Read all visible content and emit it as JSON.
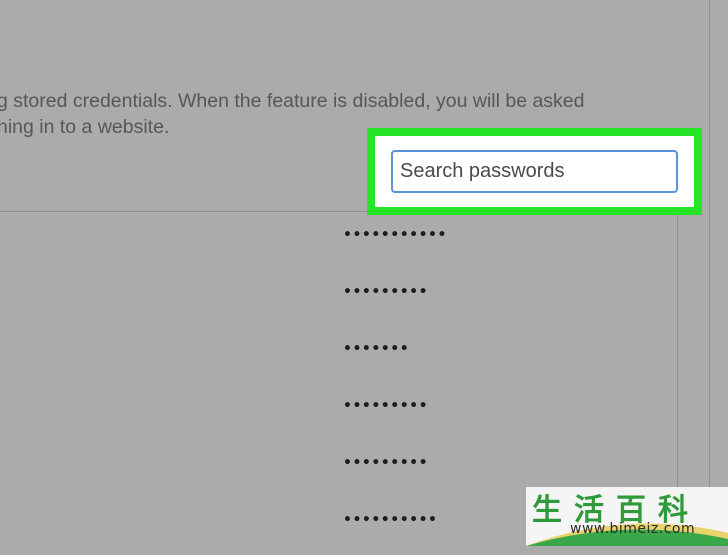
{
  "settings": {
    "description_line1": "g stored credentials. When the feature is disabled, you will be asked",
    "description_line2": "ning in to a website."
  },
  "search": {
    "placeholder": "Search passwords",
    "value": ""
  },
  "passwords": [
    {
      "masked": "•••••••••••"
    },
    {
      "masked": "•••••••••"
    },
    {
      "masked": "•••••••"
    },
    {
      "masked": "•••••••••"
    },
    {
      "masked": "•••••••••"
    },
    {
      "masked": "••••••••••"
    }
  ],
  "watermark": {
    "brand": "生活百科",
    "url": "www.bimeiz.com"
  },
  "colors": {
    "highlight": "#27e427",
    "input_border": "#5a93db",
    "overlay": "#ababab"
  }
}
